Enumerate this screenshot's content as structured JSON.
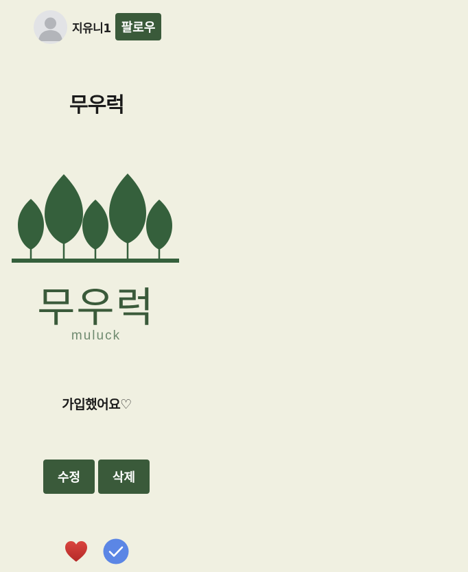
{
  "post": {
    "author": "지유니1",
    "follow_label": "팔로우",
    "title": "무우럭",
    "logo": {
      "name": "무우럭",
      "sub": "muluck"
    },
    "content": "가입했어요♡",
    "edit_label": "수정",
    "delete_label": "삭제"
  },
  "colors": {
    "background": "#f0f0e1",
    "primary": "#3a5a3a",
    "heart": "#c9302c",
    "check": "#5b86e5"
  },
  "icons": {
    "avatar": "user-avatar-icon",
    "like": "heart-icon",
    "check": "check-circle-icon"
  }
}
